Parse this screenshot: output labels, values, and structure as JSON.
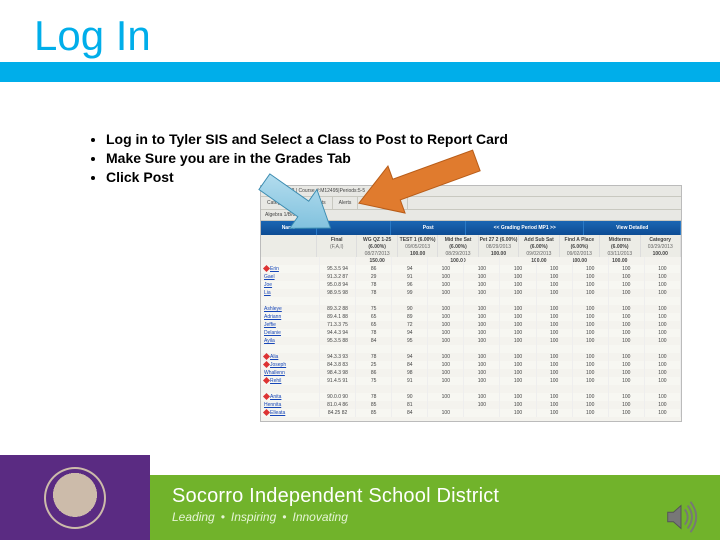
{
  "title": "Log In",
  "bullets": [
    "Log in to Tyler SIS and Select a Class to Post to Report Card",
    "Make Sure you are in the Grades Tab",
    "Click Post"
  ],
  "screenshot": {
    "classInfo": "MHS - MHS2 | Course #:M12495|Periods:5-5",
    "subhead": "Algebra 1/B/09 - 8/27/3",
    "tabs": [
      "Categories & Assignments",
      "Alerts",
      "Grade Reporting"
    ],
    "blueRow": {
      "leftLabel": "Name",
      "post": "Post",
      "gradingPeriod": "Grading Period",
      "gpSel": "MP1",
      "gpNav": [
        "<<",
        ">>"
      ],
      "view": "View",
      "viewSel": "Detailed"
    },
    "columns": [
      {
        "label": "Final",
        "sub": "(F,A,I)"
      },
      {
        "label": "WG QZ 1-25 (6.00%)",
        "sub": "08/27/2013",
        "third": "150.00"
      },
      {
        "label": "TEST 1 (6.00%)",
        "sub": "09/05/2013",
        "third": "100.00"
      },
      {
        "label": "Mid the Sat (6.00%)",
        "sub": "08/29/2013",
        "third": "100.00"
      },
      {
        "label": "Pet 27 2 (6.00%)",
        "sub": "08/29/2013",
        "third": "100.00"
      },
      {
        "label": "Add Sub Sat (6.00%)",
        "sub": "09/02/2013",
        "third": "100.00"
      },
      {
        "label": "Find A Place (6.00%)",
        "sub": "09/02/2013",
        "third": "100.00"
      },
      {
        "label": "Midterms (6.00%)",
        "sub": "03/11/2013",
        "third": "100.00"
      },
      {
        "label": "Category",
        "sub": "03/29/2013",
        "third": "100.00"
      }
    ],
    "rows": [
      {
        "name": "",
        "pin": false,
        "final": "",
        "v": [
          "",
          "",
          "",
          "",
          "",
          "",
          "",
          "",
          ""
        ]
      },
      {
        "name": "Erin",
        "pin": true,
        "final": "95.3.5   94",
        "v": [
          "86",
          "94",
          "100",
          "100",
          "100",
          "100",
          "100",
          "100",
          "100"
        ]
      },
      {
        "name": "Gael",
        "pin": false,
        "final": "91.3.2   87",
        "v": [
          "29",
          "91",
          "100",
          "100",
          "100",
          "100",
          "100",
          "100",
          "100"
        ]
      },
      {
        "name": "Joe",
        "pin": false,
        "final": "95.0.8   94",
        "v": [
          "78",
          "96",
          "100",
          "100",
          "100",
          "100",
          "100",
          "100",
          "100"
        ]
      },
      {
        "name": "Lia",
        "pin": false,
        "final": "98.9.5   98",
        "v": [
          "78",
          "99",
          "100",
          "100",
          "100",
          "100",
          "100",
          "100",
          "100"
        ]
      },
      {
        "name": "",
        "pin": false,
        "final": "",
        "v": [
          "",
          "",
          "",
          "",
          "",
          "",
          "",
          "",
          ""
        ]
      },
      {
        "name": "Ashleye",
        "pin": false,
        "final": "89.3.2   88",
        "v": [
          "75",
          "90",
          "100",
          "100",
          "100",
          "100",
          "100",
          "100",
          "100"
        ]
      },
      {
        "name": "Adriann",
        "pin": false,
        "final": "89.4.1   88",
        "v": [
          "65",
          "89",
          "100",
          "100",
          "100",
          "100",
          "100",
          "100",
          "100"
        ]
      },
      {
        "name": "Jeffie",
        "pin": false,
        "final": "71.3.3   75",
        "v": [
          "65",
          "72",
          "100",
          "100",
          "100",
          "100",
          "100",
          "100",
          "100"
        ]
      },
      {
        "name": "Delanie",
        "pin": false,
        "final": "94.4.3   94",
        "v": [
          "78",
          "94",
          "100",
          "100",
          "100",
          "100",
          "100",
          "100",
          "100"
        ]
      },
      {
        "name": "Ayila",
        "pin": false,
        "final": "95.3.5   88",
        "v": [
          "84",
          "95",
          "100",
          "100",
          "100",
          "100",
          "100",
          "100",
          "100"
        ]
      },
      {
        "name": "",
        "pin": false,
        "final": "",
        "v": [
          "",
          "",
          "",
          "",
          "",
          "",
          "",
          "",
          ""
        ]
      },
      {
        "name": "Alia",
        "pin": true,
        "final": "94.3.3   93",
        "v": [
          "78",
          "94",
          "100",
          "100",
          "100",
          "100",
          "100",
          "100",
          "100"
        ]
      },
      {
        "name": "Joseph",
        "pin": true,
        "final": "84.3.8   83",
        "v": [
          "25",
          "84",
          "100",
          "100",
          "100",
          "100",
          "100",
          "100",
          "100"
        ]
      },
      {
        "name": "Whallenn",
        "pin": false,
        "final": "98.4.3   98",
        "v": [
          "86",
          "98",
          "100",
          "100",
          "100",
          "100",
          "100",
          "100",
          "100"
        ]
      },
      {
        "name": "Rehil",
        "pin": true,
        "final": "91.4.5   91",
        "v": [
          "75",
          "91",
          "100",
          "100",
          "100",
          "100",
          "100",
          "100",
          "100"
        ]
      },
      {
        "name": "",
        "pin": false,
        "final": "",
        "v": [
          "",
          "",
          "",
          "",
          "",
          "",
          "",
          "",
          ""
        ]
      },
      {
        "name": "Anita",
        "pin": true,
        "final": "90.0.0   90",
        "v": [
          "78",
          "90",
          "100",
          "100",
          "100",
          "100",
          "100",
          "100",
          "100"
        ]
      },
      {
        "name": "Hennita",
        "pin": false,
        "final": "81.0.4   86",
        "v": [
          "85",
          "81",
          "",
          "100",
          "100",
          "100",
          "100",
          "100",
          "100"
        ]
      },
      {
        "name": "Elleata",
        "pin": true,
        "final": "84.25   82",
        "v": [
          "85",
          "84",
          "100",
          "",
          "100",
          "100",
          "100",
          "100",
          "100"
        ]
      }
    ]
  },
  "footer": {
    "district": "Socorro Independent School District",
    "tagline": [
      "Leading",
      "Inspiring",
      "Innovating"
    ]
  },
  "icons": {
    "speaker": "speaker-icon",
    "seal": "district-seal"
  }
}
